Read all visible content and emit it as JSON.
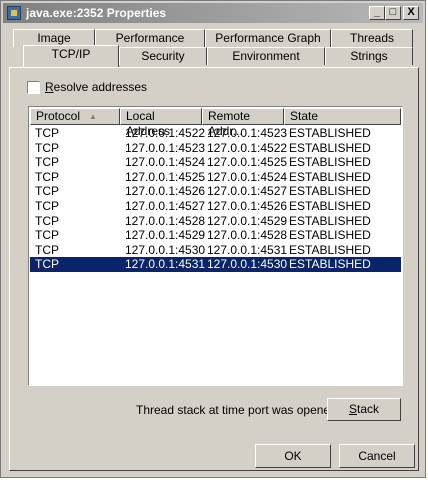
{
  "window": {
    "title": "java.exe:2352 Properties"
  },
  "titlebar_buttons": {
    "minimize": "_",
    "maximize": "□",
    "close": "X"
  },
  "tabs": {
    "row_back": [
      "Image",
      "Performance",
      "Performance Graph",
      "Threads"
    ],
    "row_front": [
      "TCP/IP",
      "Security",
      "Environment",
      "Strings"
    ],
    "active": "TCP/IP"
  },
  "resolve_addresses": {
    "label": "Resolve addresses",
    "checked": false
  },
  "table": {
    "columns": [
      "Protocol",
      "Local Address",
      "Remote Addr...",
      "State"
    ],
    "sort_indicator": "▲",
    "rows": [
      [
        "TCP",
        "127.0.0.1:4522",
        "127.0.0.1:4523",
        "ESTABLISHED"
      ],
      [
        "TCP",
        "127.0.0.1:4523",
        "127.0.0.1:4522",
        "ESTABLISHED"
      ],
      [
        "TCP",
        "127.0.0.1:4524",
        "127.0.0.1:4525",
        "ESTABLISHED"
      ],
      [
        "TCP",
        "127.0.0.1:4525",
        "127.0.0.1:4524",
        "ESTABLISHED"
      ],
      [
        "TCP",
        "127.0.0.1:4526",
        "127.0.0.1:4527",
        "ESTABLISHED"
      ],
      [
        "TCP",
        "127.0.0.1:4527",
        "127.0.0.1:4526",
        "ESTABLISHED"
      ],
      [
        "TCP",
        "127.0.0.1:4528",
        "127.0.0.1:4529",
        "ESTABLISHED"
      ],
      [
        "TCP",
        "127.0.0.1:4529",
        "127.0.0.1:4528",
        "ESTABLISHED"
      ],
      [
        "TCP",
        "127.0.0.1:4530",
        "127.0.0.1:4531",
        "ESTABLISHED"
      ],
      [
        "TCP",
        "127.0.0.1:4531",
        "127.0.0.1:4530",
        "ESTABLISHED"
      ]
    ],
    "selected_row": 9
  },
  "footer": {
    "thread_stack_text": "Thread stack at time port was opened",
    "stack_button": "Stack",
    "ok_button": "OK",
    "cancel_button": "Cancel"
  },
  "colors": {
    "selection": "#0a246a",
    "face": "#d4d0c8"
  }
}
